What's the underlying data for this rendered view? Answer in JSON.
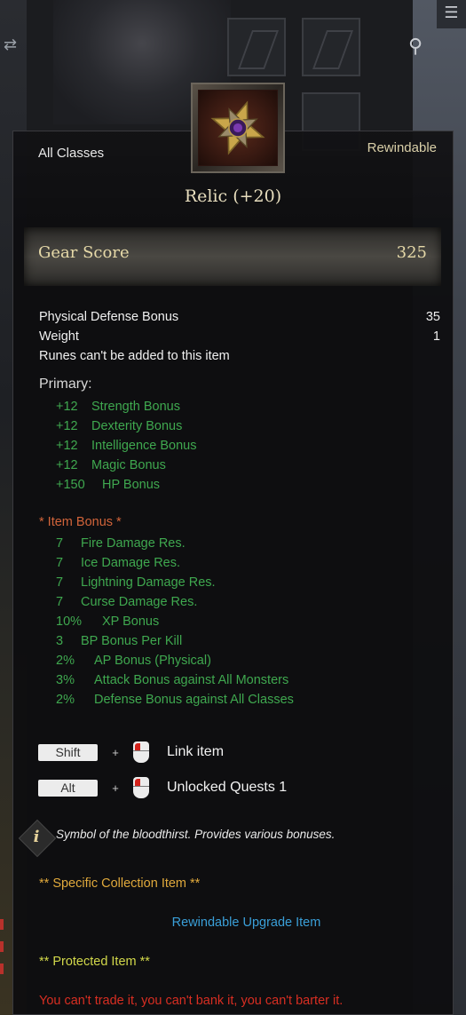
{
  "item": {
    "class_restriction": "All Classes",
    "rewind_status": "Rewindable",
    "name": "Relic (+20)",
    "gear_score_label": "Gear Score",
    "gear_score_value": "325"
  },
  "base_stats": [
    {
      "label": "Physical Defense Bonus",
      "value": "35"
    },
    {
      "label": "Weight",
      "value": "1"
    },
    {
      "label": "Runes can't be added to this item",
      "value": ""
    }
  ],
  "primary": {
    "title": "Primary:",
    "stats": [
      {
        "value": "+12",
        "label": "Strength Bonus"
      },
      {
        "value": "+12",
        "label": "Dexterity Bonus"
      },
      {
        "value": "+12",
        "label": "Intelligence Bonus"
      },
      {
        "value": "+12",
        "label": "Magic Bonus"
      },
      {
        "value": "+150",
        "label": "HP Bonus"
      }
    ]
  },
  "item_bonus": {
    "title": "* Item Bonus *",
    "stats": [
      {
        "value": "7",
        "label": "Fire Damage Res."
      },
      {
        "value": "7",
        "label": "Ice Damage Res."
      },
      {
        "value": "7",
        "label": "Lightning Damage Res."
      },
      {
        "value": "7",
        "label": "Curse Damage Res."
      },
      {
        "value": "10%",
        "label": "XP Bonus"
      },
      {
        "value": "3",
        "label": "BP Bonus Per Kill"
      },
      {
        "value": "2%",
        "label": "AP Bonus (Physical)"
      },
      {
        "value": "3%",
        "label": "Attack Bonus against All Monsters"
      },
      {
        "value": "2%",
        "label": "Defense Bonus against All Classes"
      }
    ]
  },
  "shortcuts": [
    {
      "key": "Shift",
      "plus": "+",
      "action": "Link item"
    },
    {
      "key": "Alt",
      "plus": "+",
      "action": "Unlocked Quests 1"
    }
  ],
  "description": "Symbol of the bloodthirst. Provides various bonuses.",
  "notes": {
    "collection": "** Specific Collection Item **",
    "rewindable_upgrade": "Rewindable Upgrade Item",
    "protected": "** Protected Item **",
    "restrictions": "You can't trade it, you can't bank it, you can't barter it."
  },
  "colors": {
    "green": "#3fa84f",
    "orange": "#d2643a",
    "gold": "#e0a93c",
    "blue": "#3a9fd8",
    "yellow": "#d2d84a",
    "red": "#d82e22"
  },
  "icons": [
    "relic-item-icon",
    "menu-icon",
    "zoom-icon",
    "info-icon",
    "mouse-left-click-icon"
  ]
}
